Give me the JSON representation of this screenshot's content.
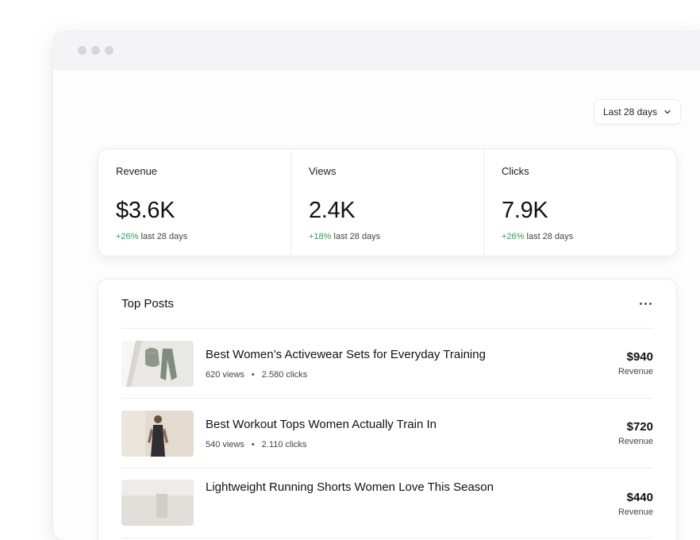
{
  "date_range": {
    "label": "Last 28 days"
  },
  "stats": [
    {
      "label": "Revenue",
      "value": "$3.6K",
      "change": "+26%",
      "period": "last 28 days"
    },
    {
      "label": "Views",
      "value": "2.4K",
      "change": "+18%",
      "period": "last 28 days"
    },
    {
      "label": "Clicks",
      "value": "7.9K",
      "change": "+26%",
      "period": "last 28 days"
    }
  ],
  "top_posts": {
    "title": "Top Posts",
    "items": [
      {
        "title": "Best Women’s Activewear Sets for Everyday Training",
        "views": "620 views",
        "clicks": "2.580 clicks",
        "revenue": "$940",
        "revenue_label": "Revenue"
      },
      {
        "title": "Best Workout Tops Women Actually Train In",
        "views": "540 views",
        "clicks": "2.110 clicks",
        "revenue": "$720",
        "revenue_label": "Revenue"
      },
      {
        "title": "Lightweight Running Shorts Women Love This Season",
        "views": "",
        "clicks": "",
        "revenue": "$440",
        "revenue_label": "Revenue"
      }
    ]
  },
  "colors": {
    "positive": "#22a454"
  }
}
